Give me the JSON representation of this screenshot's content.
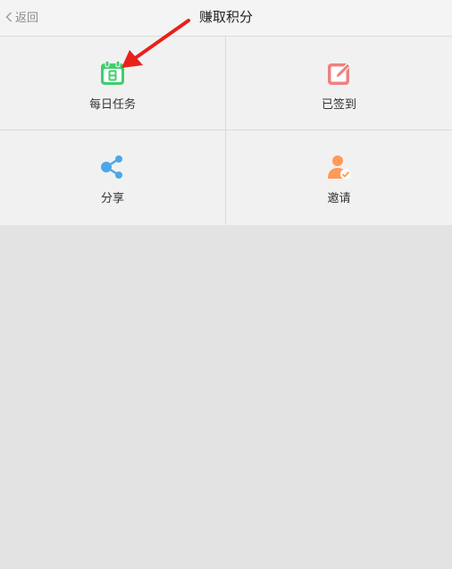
{
  "header": {
    "back_label": "返回",
    "title": "赚取积分"
  },
  "grid": {
    "items": [
      {
        "label": "每日任务",
        "icon": "calendar-icon",
        "color": "#3ecf6e"
      },
      {
        "label": "已签到",
        "icon": "edit-icon",
        "color": "#f08080"
      },
      {
        "label": "分享",
        "icon": "share-icon",
        "color": "#4aa8e8"
      },
      {
        "label": "邀请",
        "icon": "invite-user-icon",
        "color": "#ff9a5a"
      }
    ]
  },
  "annotation": {
    "color": "#e8211b",
    "icon": "red-arrow-annotation"
  }
}
